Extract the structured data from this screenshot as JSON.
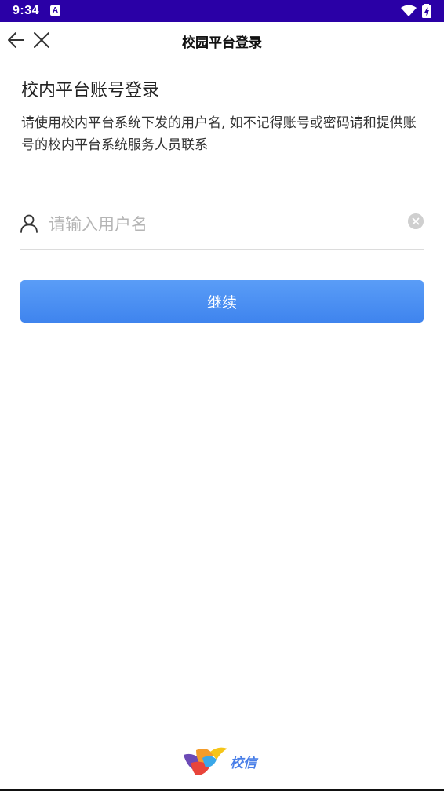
{
  "status_bar": {
    "time": "9:34",
    "notification_badge": "A",
    "color": "#2a00a6"
  },
  "header": {
    "title": "校园平台登录",
    "back_icon": "arrow-left-icon",
    "close_icon": "close-icon"
  },
  "login": {
    "heading": "校内平台账号登录",
    "description": "请使用校内平台系统下发的用户名, 如不记得账号或密码请和提供账号的校内平台系统服务人员联系",
    "username": {
      "value": "",
      "placeholder": "请输入用户名",
      "icon": "user-icon",
      "clear_icon": "clear-icon"
    },
    "continue_label": "继续",
    "accent_color": "#4a8df3"
  },
  "footer": {
    "brand_name": "校信"
  }
}
